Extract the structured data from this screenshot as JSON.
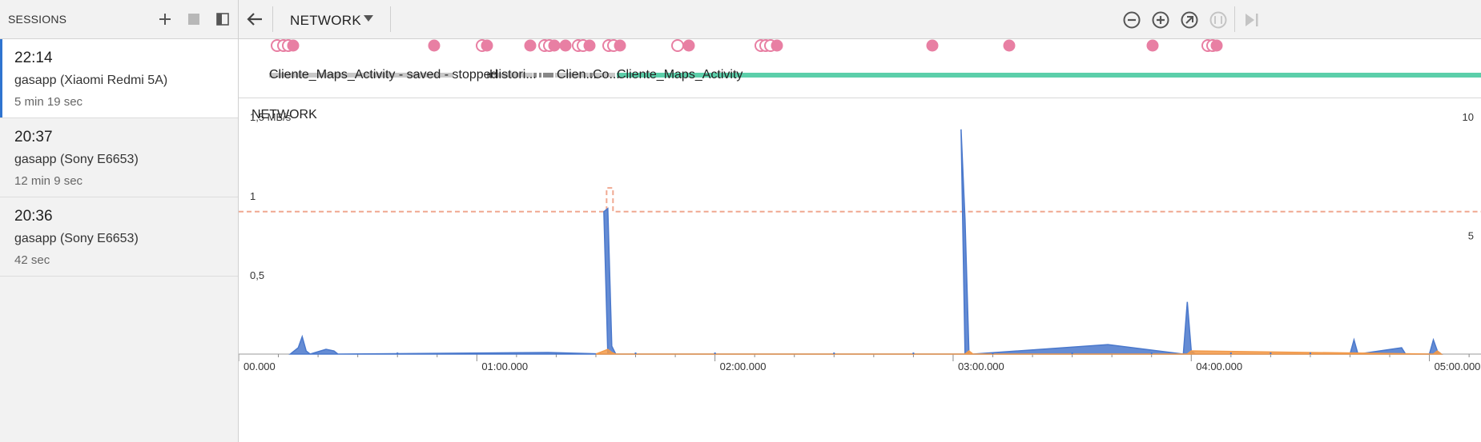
{
  "sessions_panel": {
    "title": "SESSIONS",
    "sessions": [
      {
        "time": "22:14",
        "device": "gasapp (Xiaomi Redmi 5A)",
        "duration": "5 min 19 sec",
        "selected": true
      },
      {
        "time": "20:37",
        "device": "gasapp (Sony E6653)",
        "duration": "12 min 9 sec",
        "selected": false
      },
      {
        "time": "20:36",
        "device": "gasapp (Sony E6653)",
        "duration": "42 sec",
        "selected": false
      }
    ]
  },
  "toolbar": {
    "monitor": "NETWORK",
    "icons": [
      "back-arrow-icon",
      "zoom-out-icon",
      "zoom-in-icon",
      "reset-zoom-icon",
      "zoom-to-selection-icon",
      "go-live-icon"
    ]
  },
  "events": {
    "activity_labels": [
      "Cliente_Maps_Activity - saved - stopped",
      "Histori...",
      "Clien...",
      "Co...",
      "Cliente_Maps_Activity"
    ]
  },
  "colors": {
    "accent": "#2f74d0",
    "event_dot": "#e87fa3",
    "active_bar": "#5ccfaa",
    "received": "#4a78cc",
    "sent": "#f29a4a",
    "connections": "#f0a890"
  },
  "chart_data": {
    "type": "area",
    "title": "NETWORK",
    "y_left": {
      "unit": "1,5 MB/s",
      "ticks": [
        "1,5 MB/s",
        "1",
        "0,5"
      ],
      "max": 1.5
    },
    "y_right": {
      "ticks": [
        "10",
        "5"
      ],
      "max": 10
    },
    "x_ticks": [
      "00.000",
      "01:00.000",
      "02:00.000",
      "03:00.000",
      "04:00.000",
      "05:00.000"
    ],
    "x_range_sec": [
      0,
      313
    ],
    "series": [
      {
        "key": "received",
        "x": [
          13,
          15,
          16,
          17,
          18,
          22,
          24,
          25,
          78,
          93,
          92,
          93,
          94,
          95,
          183,
          182,
          183,
          184,
          185,
          219,
          238,
          239,
          240,
          241,
          280,
          281,
          282,
          293,
          294,
          300,
          301,
          302,
          303
        ],
        "values": [
          0.0,
          0.04,
          0.11,
          0.02,
          0.0,
          0.03,
          0.02,
          0.0,
          0.01,
          0.0,
          0.9,
          0.92,
          0.05,
          0.0,
          0.0,
          1.42,
          0.85,
          0.0,
          0.0,
          0.06,
          0.0,
          0.33,
          0.02,
          0.0,
          0.0,
          0.09,
          0.0,
          0.04,
          0.0,
          0.0,
          0.09,
          0.02,
          0.0
        ]
      },
      {
        "key": "sent",
        "x": [
          90,
          92,
          93,
          94,
          95,
          183,
          184,
          185,
          239,
          240,
          301,
          302,
          303
        ],
        "values": [
          0.0,
          0.02,
          0.03,
          0.01,
          0.0,
          0.0,
          0.02,
          0.0,
          0.0,
          0.02,
          0.0,
          0.02,
          0.0
        ]
      },
      {
        "key": "connections",
        "constant": 6,
        "spike_at": 93.5,
        "spike_value": 7
      }
    ]
  }
}
